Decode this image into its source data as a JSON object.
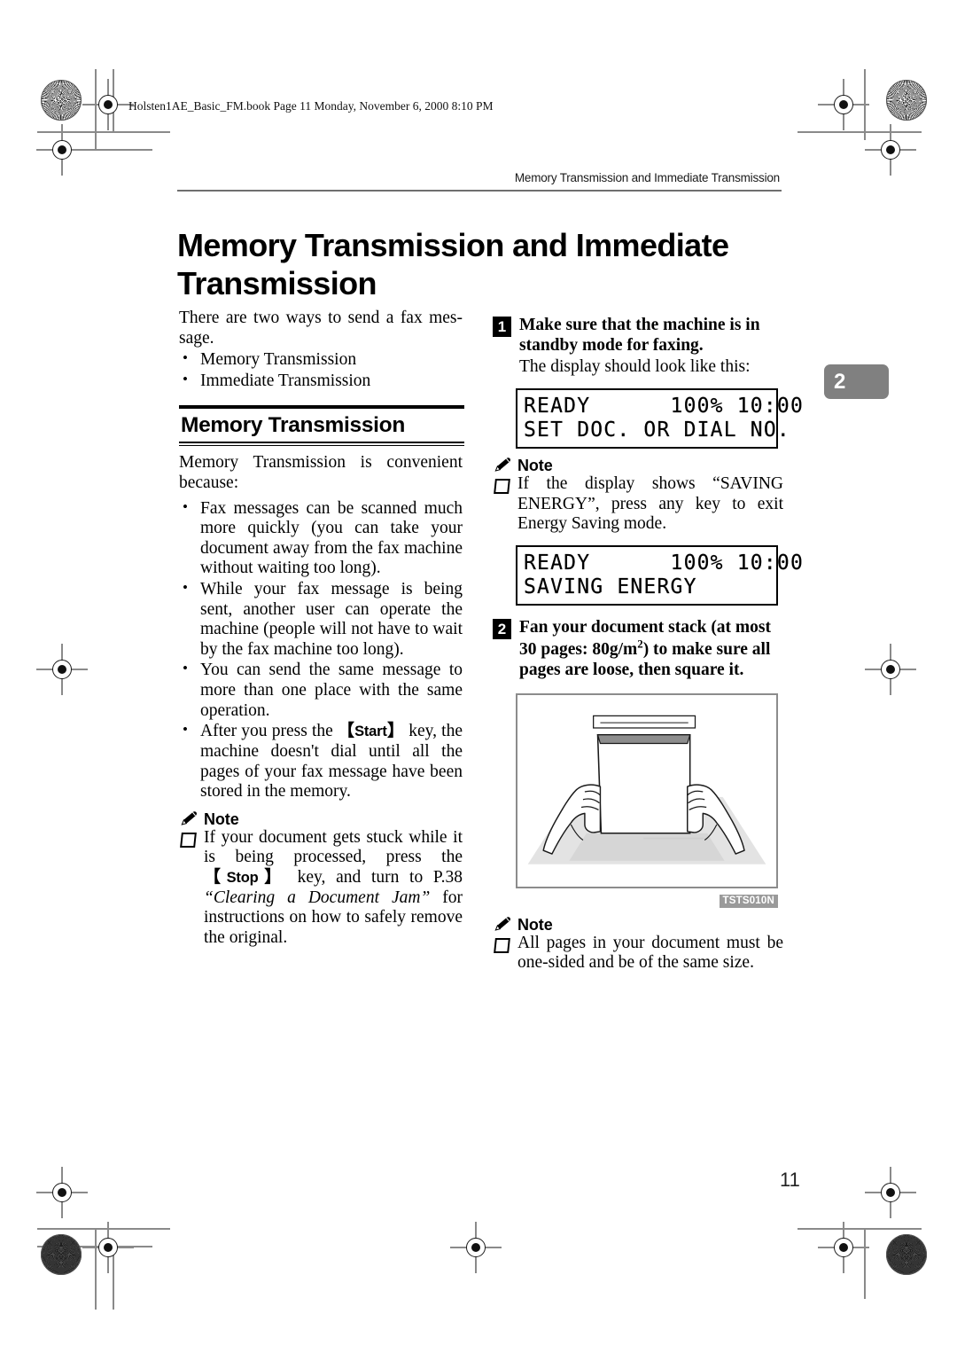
{
  "file_stamp": "Holsten1AE_Basic_FM.book  Page 11  Monday, November 6, 2000  8:10 PM",
  "running_head": "Memory Transmission and Immediate Transmission",
  "page_title": "Memory Transmission and Immediate Transmission",
  "chapter_tab": "2",
  "page_number": "11",
  "left_column": {
    "intro": "There are two ways to send a fax mes-sage.",
    "intro_bullets": [
      "Memory Transmission",
      "Immediate Transmission"
    ],
    "section_heading": "Memory Transmission",
    "section_intro": "Memory Transmission is convenient because:",
    "benefit_bullets": [
      "Fax messages can be scanned much more quickly (you can take your document away from the fax machine without waiting too long).",
      "While your fax message is being sent, another user can operate the machine (people will not have to wait by the fax machine too long).",
      "You can send the same message to more than one place with the same operation."
    ],
    "start_bullet": {
      "before": "After you press the ",
      "key": "Start",
      "after": " key, the machine doesn't dial until all the pages of your fax message have been stored in the memory."
    },
    "note_label": "Note",
    "note": {
      "part1": "If your document gets stuck while it is being processed, press the ",
      "key": "Stop",
      "part2": " key, and turn to P.38 ",
      "reference": "“Clearing a Document Jam”",
      "part3": " for instructions on how to safely remove the original."
    }
  },
  "right_column": {
    "step1": {
      "number": "1",
      "heading": "Make sure that the machine is in standby mode for faxing.",
      "subtext": "The display should look like this:"
    },
    "lcd1": {
      "line1": "READY      100% 10:00",
      "line2": "SET DOC. OR DIAL NO."
    },
    "note1_label": "Note",
    "note1_text": "If the display shows “SAVING ENERGY”, press any key to exit Energy Saving mode.",
    "lcd2": {
      "line1": "READY      100% 10:00",
      "line2": "SAVING ENERGY"
    },
    "step2": {
      "number": "2",
      "heading_part1": "Fan your document stack (at most 30 pages: 80g/m",
      "heading_sup": "2",
      "heading_part2": ") to make sure all pages are loose, then square it."
    },
    "figure_code": "TSTS010N",
    "note2_label": "Note",
    "note2_text": "All pages in your document must be one-sided and be of the same size."
  },
  "colors": {
    "chapter_tab_bg": "#808080",
    "rule": "#6f6f6f",
    "figure_border": "#8c8c8c",
    "figure_code_bg": "#9a9a9a"
  }
}
